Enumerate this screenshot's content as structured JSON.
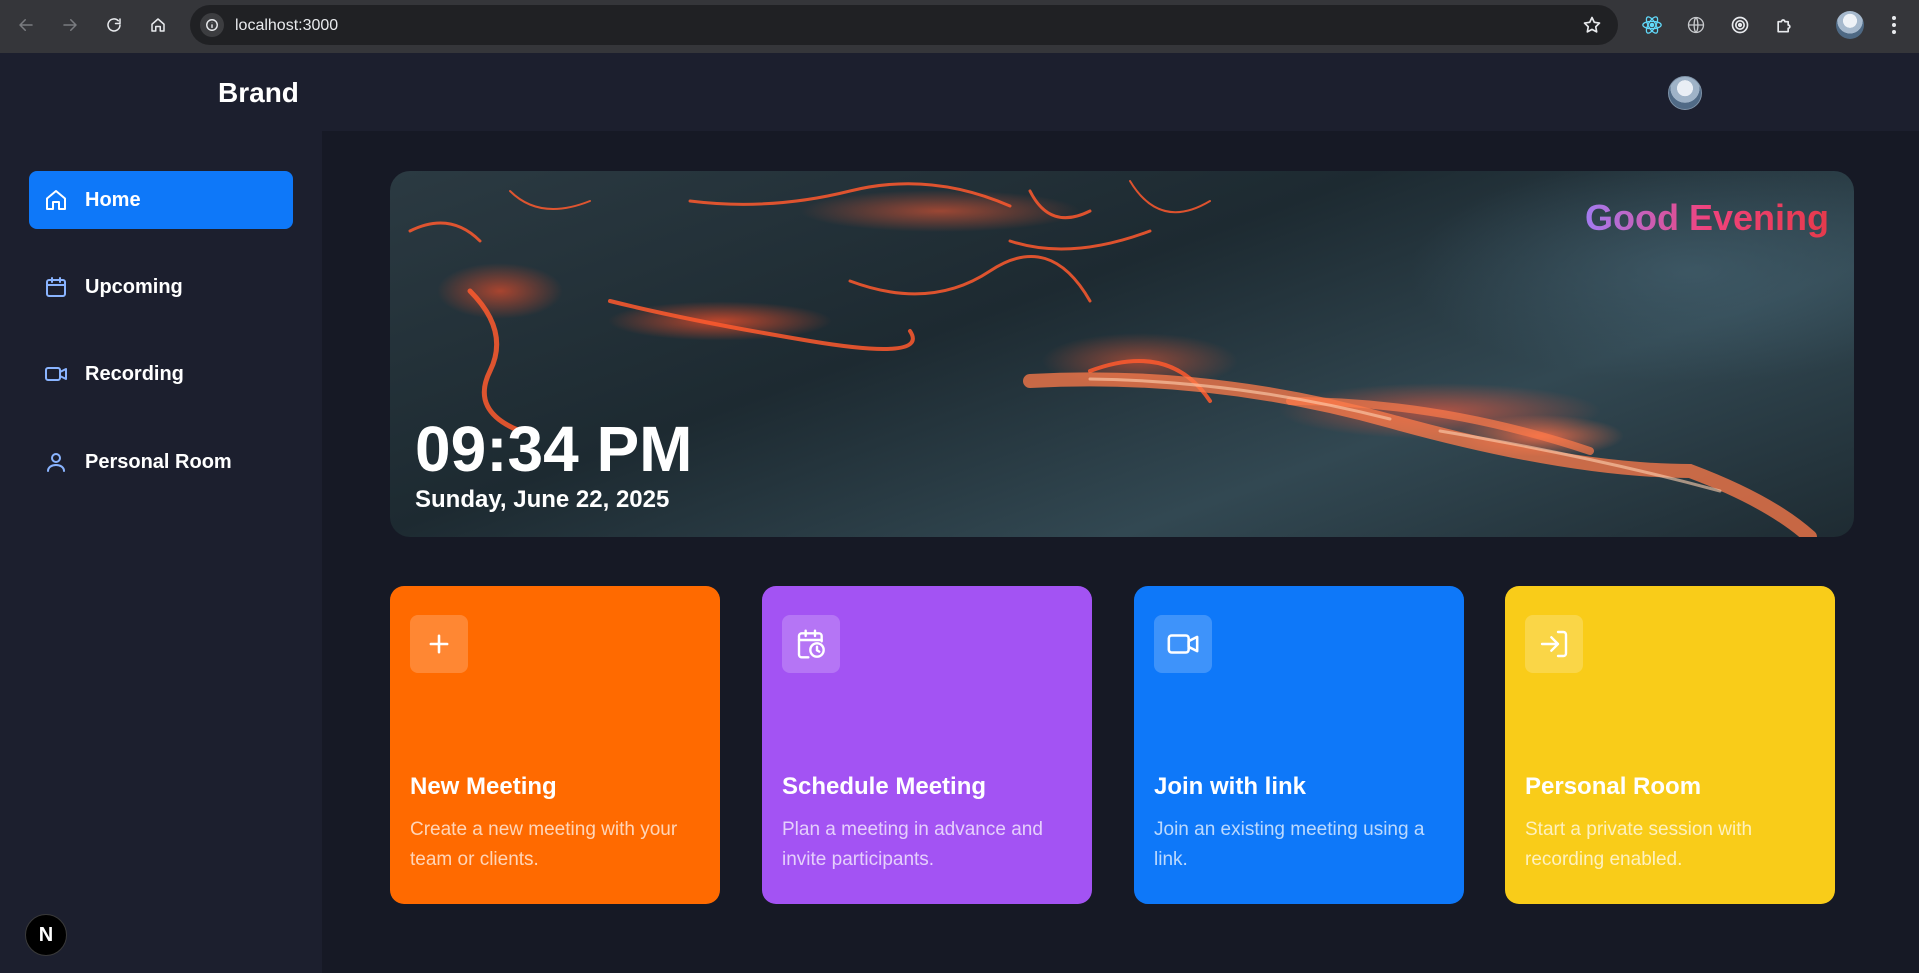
{
  "browser": {
    "url": "localhost:3000"
  },
  "app": {
    "brand": "Brand"
  },
  "sidebar": {
    "items": [
      {
        "label": "Home",
        "icon": "home-icon",
        "active": true
      },
      {
        "label": "Upcoming",
        "icon": "calendar-icon",
        "active": false
      },
      {
        "label": "Recording",
        "icon": "video-icon",
        "active": false
      },
      {
        "label": "Personal Room",
        "icon": "user-icon",
        "active": false
      }
    ],
    "badge": "N"
  },
  "hero": {
    "greeting": "Good Evening",
    "time": "09:34 PM",
    "date": "Sunday, June 22, 2025"
  },
  "cards": [
    {
      "title": "New Meeting",
      "description": "Create a new meeting with your team or clients.",
      "color": "#ff6a00",
      "icon": "plus-icon"
    },
    {
      "title": "Schedule Meeting",
      "description": "Plan a meeting in advance and invite participants.",
      "color": "#a353f3",
      "icon": "calendar-clock-icon"
    },
    {
      "title": "Join with link",
      "description": "Join an existing meeting using a link.",
      "color": "#0e78f9",
      "icon": "video-icon"
    },
    {
      "title": "Personal Room",
      "description": "Start a private session with recording enabled.",
      "color": "#f9cc19",
      "icon": "log-in-icon"
    }
  ],
  "colors": {
    "accent": "#0e78f9",
    "sidebar_bg": "#1c1f2e",
    "main_bg": "#161925"
  }
}
